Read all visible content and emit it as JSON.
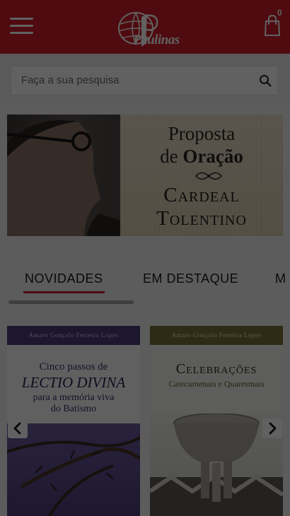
{
  "header": {
    "menu_icon": "hamburger-menu-icon",
    "logo_text": "Paulinas",
    "cart_icon": "shopping-bag-icon",
    "cart_count": "0",
    "brand_color": "#cf1f2c"
  },
  "search": {
    "placeholder": "Faça a sua pesquisa",
    "icon": "search-icon"
  },
  "banner": {
    "line1": "Proposta",
    "line2_prefix": "de ",
    "line2_bold": "Oração",
    "line3": "Cardeal",
    "line4": "Tolentino"
  },
  "tabs": [
    {
      "label": "NOVIDADES",
      "active": true
    },
    {
      "label": "EM DESTAQUE",
      "active": false
    },
    {
      "label": "M",
      "active": false
    }
  ],
  "products": [
    {
      "author": "Amaro Gonçalo Ferreira Lopes",
      "title_line1": "Cinco passos de",
      "title_line2": "LECTIO DIVINA",
      "title_line3": "para a memória viva",
      "title_line4": "do Batismo"
    },
    {
      "author": "Amaro Gonçalo Ferreira Lopes",
      "title_line1": "Celebrações",
      "title_line2": "Catecumenais e Quaresmais"
    }
  ],
  "carousel": {
    "prev_icon": "chevron-left-icon",
    "next_icon": "chevron-right-icon"
  }
}
